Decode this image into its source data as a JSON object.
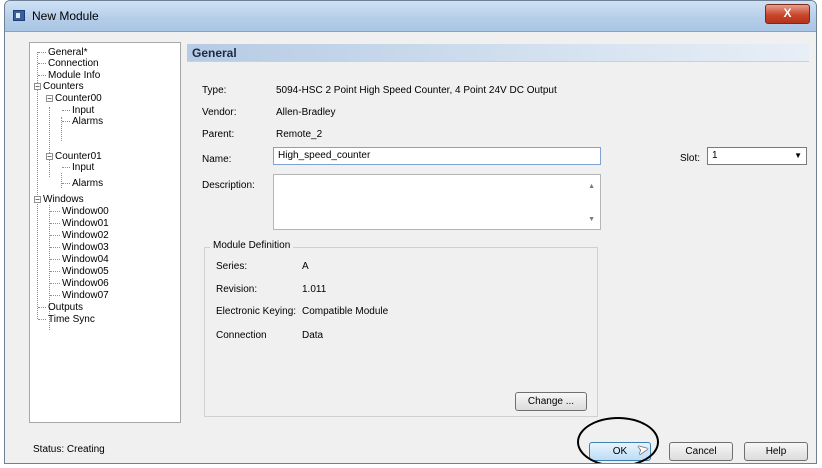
{
  "window": {
    "title": "New Module",
    "close_label": "X"
  },
  "tree": {
    "items": [
      "General*",
      "Connection",
      "Module Info",
      "Counters",
      "Counter00",
      "Input",
      "Alarms",
      "Counter01",
      "Input",
      "Alarms",
      "Windows",
      "Window00",
      "Window01",
      "Window02",
      "Window03",
      "Window04",
      "Window05",
      "Window06",
      "Window07",
      "Outputs",
      "Time Sync"
    ],
    "expander_symbol": "−"
  },
  "panel": {
    "header": "General",
    "type_label": "Type:",
    "type_value": "5094-HSC  2 Point High Speed Counter, 4 Point 24V DC Output",
    "vendor_label": "Vendor:",
    "vendor_value": "Allen-Bradley",
    "parent_label": "Parent:",
    "parent_value": "Remote_2",
    "name_label": "Name:",
    "name_value": "High_speed_counter",
    "description_label": "Description:",
    "slot_label": "Slot:",
    "slot_value": "1"
  },
  "module_definition": {
    "title": "Module Definition",
    "series_label": "Series:",
    "series_value": "A",
    "revision_label": "Revision:",
    "revision_value": "1.011",
    "keying_label": "Electronic Keying:",
    "keying_value": "Compatible Module",
    "connection_label": "Connection",
    "connection_value": "Data",
    "change_button": "Change ..."
  },
  "footer": {
    "status": "Status: Creating",
    "ok": "OK",
    "cancel": "Cancel",
    "help": "Help"
  }
}
